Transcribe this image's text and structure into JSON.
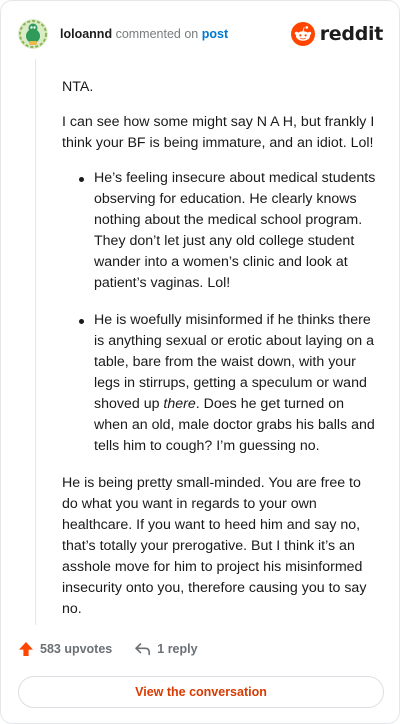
{
  "header": {
    "username": "loloannd",
    "action": "commented on",
    "post_link": "post",
    "brand": "reddit"
  },
  "comment": {
    "p1": "NTA.",
    "p2": "I can see how some might say N A H, but frankly I think your BF is being immature, and an idiot. Lol!",
    "bullet1": "He’s feeling insecure about medical students observing for education. He clearly knows nothing about the medical school program. They don’t let just any old college student wander into a women’s clinic and look at patient’s vaginas. Lol!",
    "bullet2_before": "He is woefully misinformed if he thinks there is anything sexual or erotic about laying on a table, bare from the waist down, with your legs in stirrups, getting a speculum or wand shoved up ",
    "bullet2_em": "there",
    "bullet2_after": ". Does he get turned on when an old, male doctor grabs his balls and tells him to cough? I’m guessing no.",
    "p3": "He is being pretty small-minded. You are free to do what you want in regards to your own healthcare. If you want to heed him and say no, that’s totally your prerogative. But I think it’s an asshole move for him to project his misinformed insecurity onto you, therefore causing you to say no."
  },
  "footer": {
    "upvotes": "583 upvotes",
    "replies": "1 reply"
  },
  "button": {
    "label": "View the conversation"
  },
  "colors": {
    "upvote_orange": "#ff4500",
    "link_blue": "#0079d3",
    "cta_orange": "#d93a00"
  }
}
